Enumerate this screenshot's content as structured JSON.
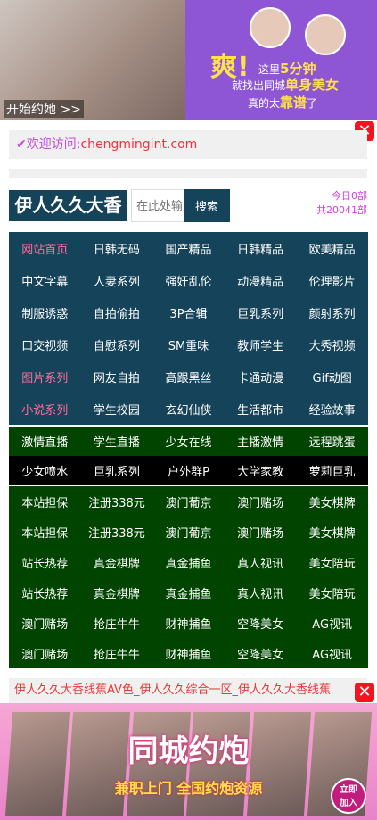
{
  "top_banner": {
    "caption": "开始约她 >>",
    "exclaim": "爽!",
    "line1_pre": "这里",
    "line1_hl": "5分钟",
    "line2_pre": "就找出同城",
    "line2_hl": "单身美女",
    "line3_pre": "真的太",
    "line3_hl": "靠谱",
    "line3_post": "了"
  },
  "close_label": "✕",
  "welcome": {
    "prefix": "✔欢迎访问:",
    "url": "chengmingint.com"
  },
  "header": {
    "logo": "伊人久久大香",
    "search_placeholder": "在此处输入",
    "search_button": "搜索",
    "today": "今日0部",
    "total": "共20041部"
  },
  "nav_blue": [
    [
      {
        "t": "网站首页",
        "pink": true
      },
      {
        "t": "日韩无码"
      },
      {
        "t": "国产精品"
      },
      {
        "t": "日韩精品"
      },
      {
        "t": "欧美精品"
      }
    ],
    [
      {
        "t": "中文字幕"
      },
      {
        "t": "人妻系列"
      },
      {
        "t": "强奸乱伦"
      },
      {
        "t": "动漫精品"
      },
      {
        "t": "伦理影片"
      }
    ],
    [
      {
        "t": "制服诱惑"
      },
      {
        "t": "自拍偷拍"
      },
      {
        "t": "3P合辑"
      },
      {
        "t": "巨乳系列"
      },
      {
        "t": "颜射系列"
      }
    ],
    [
      {
        "t": "口交视频"
      },
      {
        "t": "自慰系列"
      },
      {
        "t": "SM重味"
      },
      {
        "t": "教师学生"
      },
      {
        "t": "大秀视频"
      }
    ],
    [
      {
        "t": "图片系列",
        "pink": true
      },
      {
        "t": "网友自拍"
      },
      {
        "t": "高跟黑丝"
      },
      {
        "t": "卡通动漫"
      },
      {
        "t": "Gif动图"
      }
    ],
    [
      {
        "t": "小说系列",
        "pink": true
      },
      {
        "t": "学生校园"
      },
      {
        "t": "玄幻仙侠"
      },
      {
        "t": "生活都市"
      },
      {
        "t": "经验故事"
      }
    ]
  ],
  "nav_green1": [
    {
      "t": "激情直播"
    },
    {
      "t": "学生直播"
    },
    {
      "t": "少女在线"
    },
    {
      "t": "主播激情"
    },
    {
      "t": "远程跳蛋"
    }
  ],
  "nav_black": [
    {
      "t": "少女喷水"
    },
    {
      "t": "巨乳系列"
    },
    {
      "t": "户外群P"
    },
    {
      "t": "大学家教"
    },
    {
      "t": "萝莉巨乳"
    }
  ],
  "nav_green2": [
    [
      {
        "t": "本站担保"
      },
      {
        "t": "注册338元"
      },
      {
        "t": "澳门葡京"
      },
      {
        "t": "澳门赌场"
      },
      {
        "t": "美女棋牌"
      }
    ],
    [
      {
        "t": "本站担保"
      },
      {
        "t": "注册338元"
      },
      {
        "t": "澳门葡京"
      },
      {
        "t": "澳门赌场"
      },
      {
        "t": "美女棋牌"
      }
    ],
    [
      {
        "t": "站长热荐"
      },
      {
        "t": "真金棋牌"
      },
      {
        "t": "真金捕鱼"
      },
      {
        "t": "真人视讯"
      },
      {
        "t": "美女陪玩"
      }
    ],
    [
      {
        "t": "站长热荐"
      },
      {
        "t": "真金棋牌"
      },
      {
        "t": "真金捕鱼"
      },
      {
        "t": "真人视讯"
      },
      {
        "t": "美女陪玩"
      }
    ],
    [
      {
        "t": "澳门赌场"
      },
      {
        "t": "抢庄牛牛"
      },
      {
        "t": "财神捕鱼"
      },
      {
        "t": "空降美女"
      },
      {
        "t": "AG视讯"
      }
    ],
    [
      {
        "t": "澳门赌场"
      },
      {
        "t": "抢庄牛牛"
      },
      {
        "t": "财神捕鱼"
      },
      {
        "t": "空降美女"
      },
      {
        "t": "AG视讯"
      }
    ]
  ],
  "ad_strip": "伊人久久大香线蕉AV色_伊人久久综合一区_伊人久久大香线蕉",
  "bottom_banner": {
    "title": "同城约炮",
    "sub": "兼职上门  全国约炮资源",
    "join1": "立即",
    "join2": "加入"
  }
}
